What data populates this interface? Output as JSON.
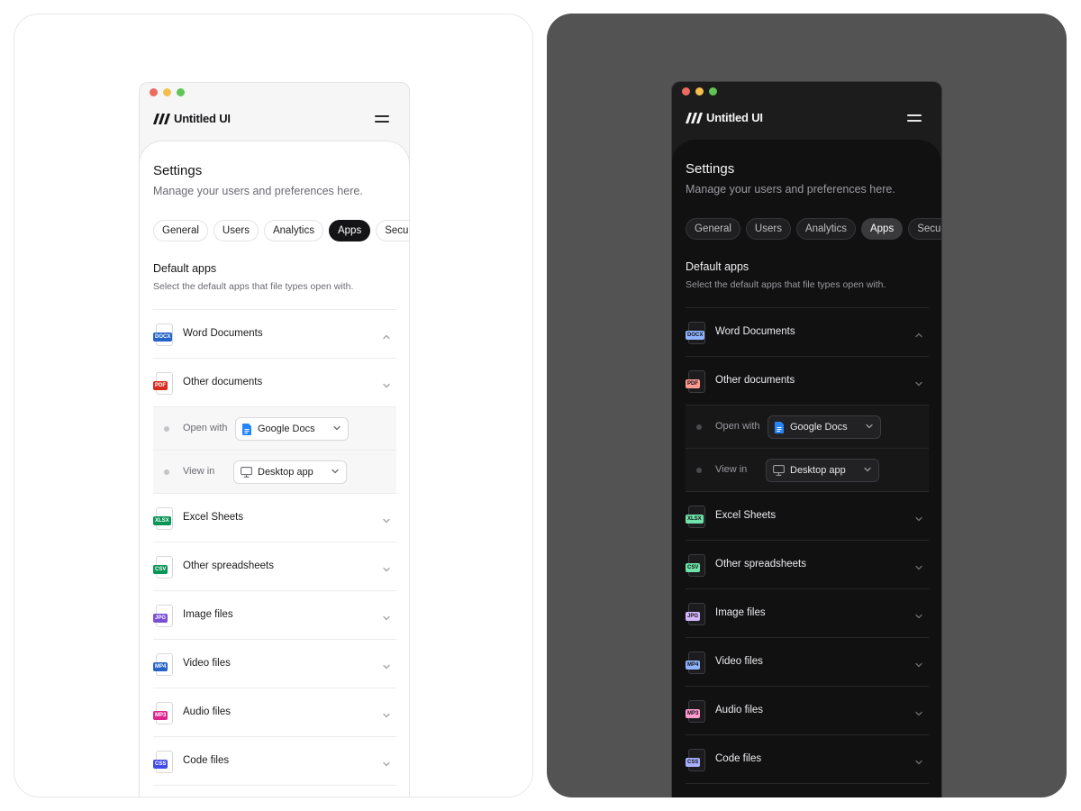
{
  "app": {
    "brand": "Untitled UI"
  },
  "settings": {
    "title": "Settings",
    "subtitle": "Manage your users and preferences here.",
    "tabs": [
      {
        "label": "General",
        "active": false
      },
      {
        "label": "Users",
        "active": false
      },
      {
        "label": "Analytics",
        "active": false
      },
      {
        "label": "Apps",
        "active": true
      },
      {
        "label": "Security",
        "active": false
      }
    ]
  },
  "default_apps": {
    "title": "Default apps",
    "description": "Select the default apps that file types open with.",
    "items": [
      {
        "label": "Word Documents",
        "badge": "DOCX",
        "color": "#2563c9",
        "expanded": true
      },
      {
        "label": "Other documents",
        "badge": "PDF",
        "color": "#d92d20",
        "expanded": false
      },
      {
        "label": "Excel Sheets",
        "badge": "XLSX",
        "color": "#079455",
        "expanded": false
      },
      {
        "label": "Other spreadsheets",
        "badge": "CSV",
        "color": "#079455",
        "expanded": false
      },
      {
        "label": "Image files",
        "badge": "JPG",
        "color": "#7a4fd6",
        "expanded": false
      },
      {
        "label": "Video files",
        "badge": "MP4",
        "color": "#2563c9",
        "expanded": false
      },
      {
        "label": "Audio files",
        "badge": "MP3",
        "color": "#dd2590",
        "expanded": false
      },
      {
        "label": "Code files",
        "badge": "CSS",
        "color": "#444ce7",
        "expanded": false
      }
    ],
    "open_with": {
      "label": "Open with",
      "value": "Google Docs"
    },
    "view_in": {
      "label": "View in",
      "value": "Desktop app"
    }
  },
  "dark_badge_colors": [
    "#8fb4ff",
    "#ff9a91",
    "#6fe3ab",
    "#6fe3ab",
    "#d3b8ff",
    "#8fb4ff",
    "#ff9ad0",
    "#a8b0ff"
  ]
}
